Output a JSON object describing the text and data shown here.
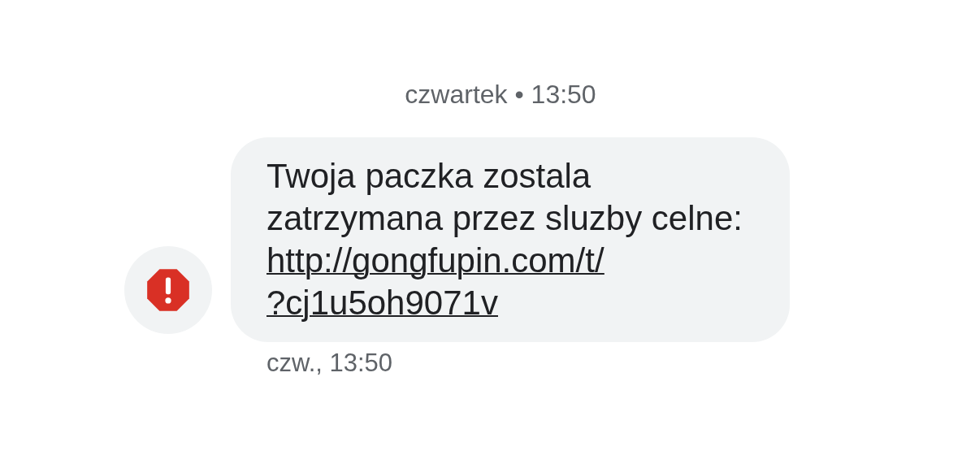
{
  "date_header": "czwartek • 13:50",
  "message": {
    "text": "Twoja paczka zostala zatrzymana przez sluzby celne: ",
    "link": "http://gongfupin.com/t/?cj1u5oh9071v",
    "timestamp": "czw., 13:50",
    "warning": true
  }
}
